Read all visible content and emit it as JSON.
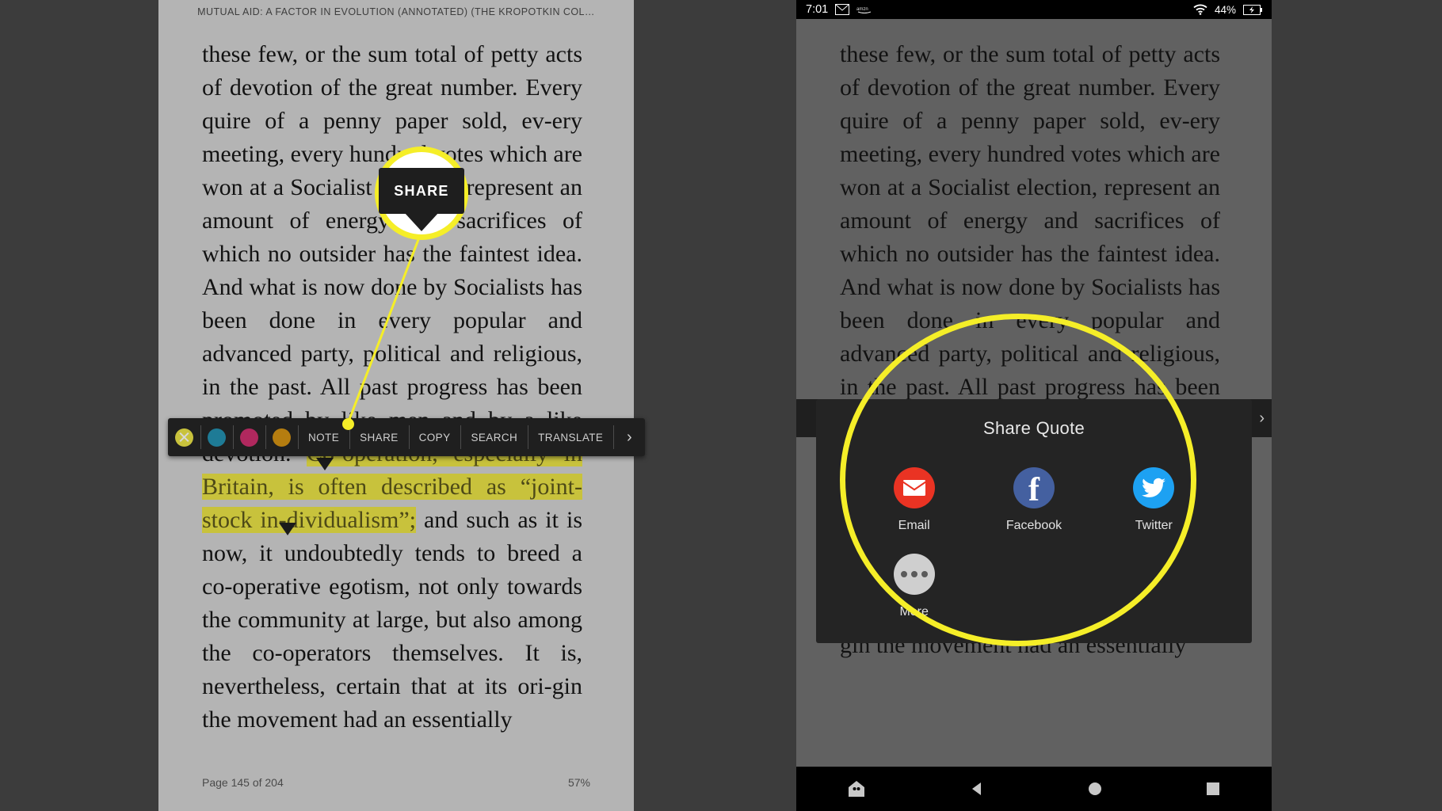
{
  "left": {
    "book_title": "MUTUAL AID: A FACTOR IN EVOLUTION (ANNOTATED) (THE KROPOTKIN COL…",
    "body_before": "these few, or the sum total of petty acts of devotion of the great number. Every quire of a penny paper sold, ev-ery meeting, every hundred votes which are won at a Socialist election, represent an amount of energy and sacrifices of which no outsider has the faintest idea. And what is now done by Socialists has been done in every popular and advanced party, political and religious, in the past. All past progress has been promoted by like men and by a like devotion. ",
    "highlight": "Co-operation, especially in Britain, is often described as “joint-stock in-dividualism”;",
    "body_after": " and such as it is now, it undoubtedly tends to breed a co-operative egotism, not only towards the community at large, but also among the co-operators themselves. It is, nevertheless, certain that at its ori-gin the movement had an essentially",
    "page_label": "Page 145 of 204",
    "progress_label": "57%"
  },
  "toolbar": {
    "swatches": [
      {
        "name": "highlight-yellow",
        "color": "#c8c23c",
        "selected": true
      },
      {
        "name": "highlight-blue",
        "color": "#1e7b96",
        "selected": false
      },
      {
        "name": "highlight-pink",
        "color": "#b0285e",
        "selected": false
      },
      {
        "name": "highlight-orange",
        "color": "#b57d10",
        "selected": false
      }
    ],
    "buttons": [
      "NOTE",
      "SHARE",
      "COPY",
      "SEARCH",
      "TRANSLATE"
    ],
    "overflow_icon": "chevron-right-icon"
  },
  "callout": {
    "bubble_label": "SHARE",
    "ring_color": "#f5ee28"
  },
  "phone": {
    "status": {
      "time": "7:01",
      "mail_icon": "envelope-icon",
      "amazon_icon": "amazon-icon",
      "wifi_icon": "wifi-icon",
      "battery_percent": "44%",
      "battery_icon": "battery-charging-icon"
    },
    "body_before": "these few, or the sum total of petty acts of devotion of the great number. Every quire of a penny paper sold, ev-ery meeting, every hundred votes which are won at a Socialist election, represent an amount of energy and sacrifices of which no outsider has the faintest idea. And what is now done by Socialists has been done in every popular and advanced party, political and religious, in the past. All past progress has been promoted by like",
    "body_after": "gin the movement had an essentially",
    "share_sheet": {
      "title": "Share Quote",
      "items": [
        {
          "label": "Email",
          "icon": "email-icon",
          "color": "#ea3323"
        },
        {
          "label": "Facebook",
          "icon": "facebook-icon",
          "color": "#4460a0"
        },
        {
          "label": "Twitter",
          "icon": "twitter-icon",
          "color": "#1da1f2"
        },
        {
          "label": "More",
          "icon": "more-dots-icon",
          "color": "#cfcfcf"
        }
      ]
    },
    "navbar": [
      {
        "name": "home-assistant-icon"
      },
      {
        "name": "back-icon"
      },
      {
        "name": "home-icon"
      },
      {
        "name": "recents-icon"
      }
    ],
    "overflow_icon": "chevron-right-icon"
  }
}
